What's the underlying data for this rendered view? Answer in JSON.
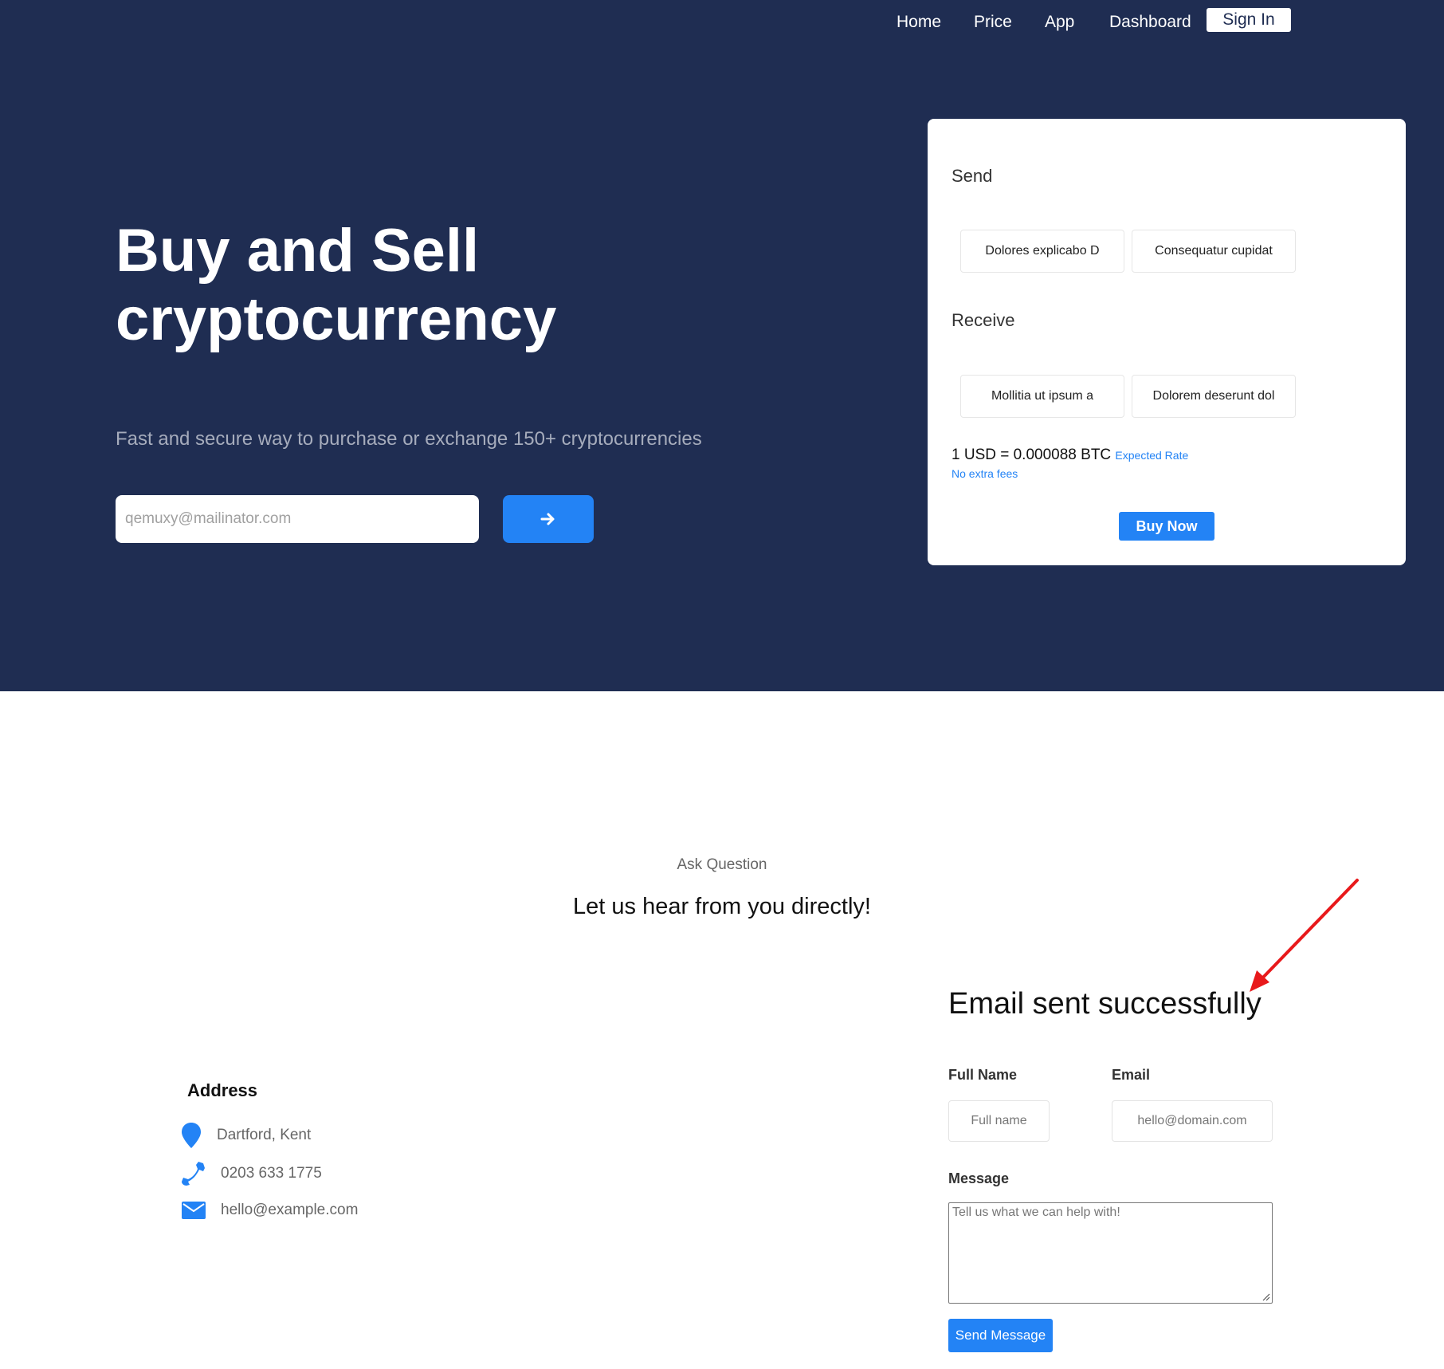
{
  "nav": {
    "items": [
      "Home",
      "Price",
      "App",
      "Dashboard"
    ],
    "sign_in": "Sign In"
  },
  "hero": {
    "title": "Buy and Sell cryptocurrency",
    "subtitle": "Fast and secure way to purchase or exchange 150+ cryptocurrencies",
    "email_placeholder": "qemuxy@mailinator.com",
    "submit_icon": "arrow-right-icon"
  },
  "exchange_card": {
    "send_label": "Send",
    "send_options": [
      "Dolores explicabo D",
      "Consequatur cupidat"
    ],
    "receive_label": "Receive",
    "receive_options": [
      "Mollitia ut ipsum a",
      "Dolorem deserunt dol"
    ],
    "rate": "1 USD = 0.000088 BTC",
    "rate_note": "Expected Rate",
    "fees": "No extra fees",
    "buy_button": "Buy Now"
  },
  "contact": {
    "eyebrow": "Ask Question",
    "heading": "Let us hear from you directly!",
    "status": "Email sent successfully",
    "address": {
      "title": "Address",
      "location": "Dartford, Kent",
      "phone": "0203 633 1775",
      "email": "hello@example.com"
    },
    "form": {
      "full_name_label": "Full Name",
      "full_name_placeholder": "Full name",
      "email_label": "Email",
      "email_placeholder": "hello@domain.com",
      "message_label": "Message",
      "message_placeholder": "Tell us what we can help with!",
      "send_button": "Send Message"
    }
  },
  "colors": {
    "hero_bg": "#1f2d52",
    "accent": "#2383f5",
    "annotation_arrow": "#e8191b"
  }
}
